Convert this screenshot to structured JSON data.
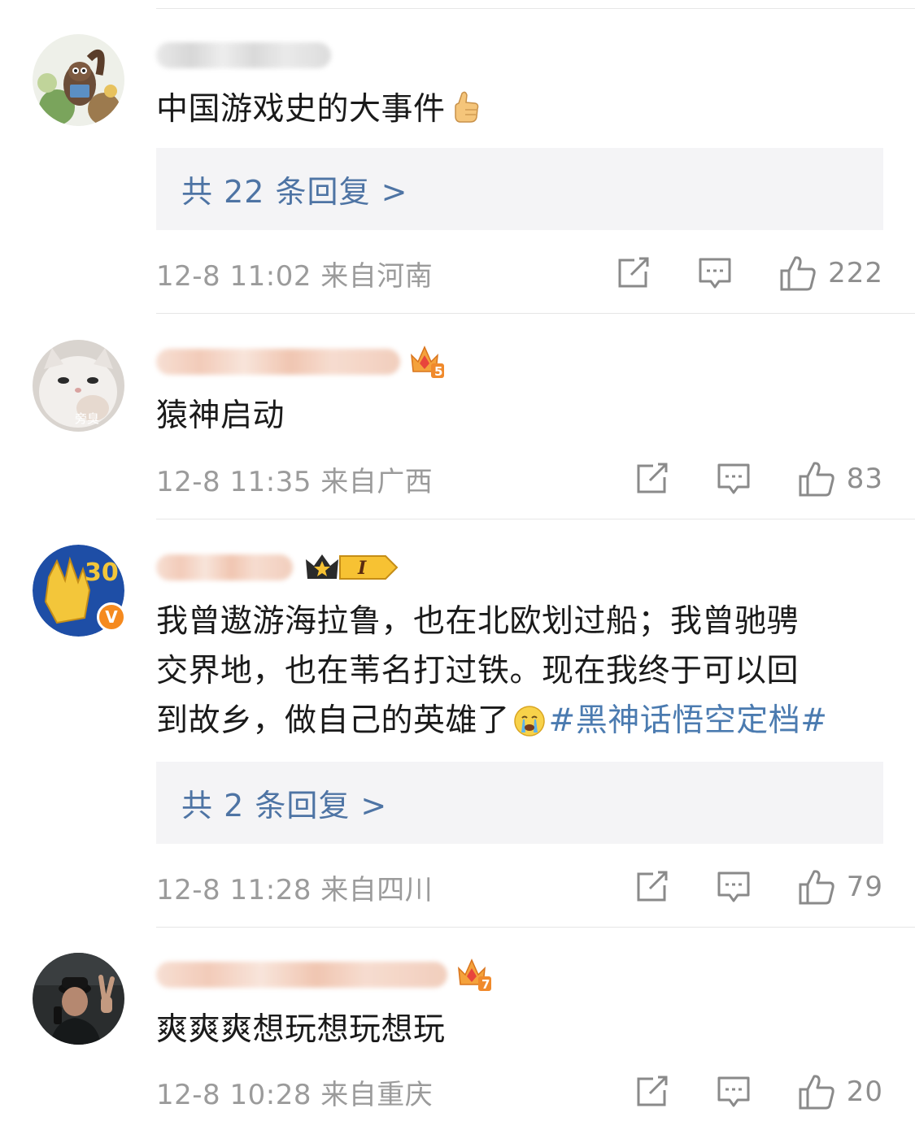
{
  "comments": [
    {
      "text": "中国游戏史的大事件",
      "emoji": "thumbs-up-emoji",
      "reply_label": "共 22 条回复 >",
      "meta": "12-8 11:02  来自河南",
      "likes": "222"
    },
    {
      "text": "猿神启动",
      "avatar_text": "旁臭",
      "level_badge": "5",
      "meta": "12-8 11:35  来自广西",
      "likes": "83"
    },
    {
      "text_line1": "我曾遨游海拉鲁，也在北欧划过船；我曾驰骋",
      "text_line2": "交界地，也在苇名打过铁。现在我终于可以回",
      "text_line3_plain": "到故乡，做自己的英雄了",
      "emoji": "crying-face-emoji",
      "hashtag": "#黑神话悟空定档#",
      "avatar_number": "30",
      "verified_mark": "V",
      "member_badge": "I",
      "reply_label": "共 2 条回复 >",
      "meta": "12-8 11:28  来自四川",
      "likes": "79"
    },
    {
      "text": "爽爽爽想玩想玩想玩",
      "level_badge": "7",
      "meta": "12-8 10:28  来自重庆",
      "likes": "20"
    }
  ],
  "icons": {
    "share": "share-icon",
    "comment": "comment-icon",
    "like": "like-icon"
  },
  "colors": {
    "link": "#4e74a4",
    "meta": "#9b9b9b",
    "reply_bg": "#f4f4f6",
    "hashtag": "#4b7bb0"
  }
}
